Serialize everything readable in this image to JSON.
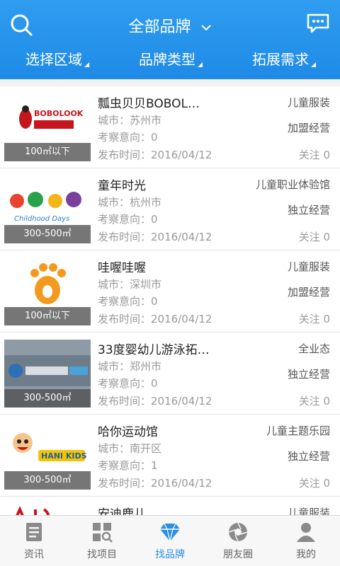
{
  "header": {
    "title": "全部品牌",
    "filters": [
      "选择区域",
      "品牌类型",
      "拓展需求"
    ],
    "colors": {
      "bar": "#2f9df0",
      "accent": "#2b8fe6"
    },
    "icons": {
      "left": "search-icon",
      "right": "message-icon",
      "title": "chevron-down-icon"
    }
  },
  "brands": [
    {
      "name": "瓢虫贝贝BOBOL…",
      "city": "城市：苏州市",
      "visits": "考察意向：0",
      "date": "发布时间：2016/04/12",
      "category": "儿童服装",
      "operation": "加盟经营",
      "follow": "关注 0",
      "area": "100㎡以下",
      "logo": "BOBOLOOK 瓢虫贝贝"
    },
    {
      "name": "童年时光",
      "city": "城市：杭州市",
      "visits": "考察意向：0",
      "date": "发布时间：2016/04/12",
      "category": "儿童职业体验馆",
      "operation": "独立经营",
      "follow": "关注 0",
      "area": "300-500㎡",
      "logo": "童年时光 Childhood Days"
    },
    {
      "name": "哇喔哇喔",
      "city": "城市：深圳市",
      "visits": "考察意向：0",
      "date": "发布时间：2016/04/12",
      "category": "儿童服装",
      "operation": "加盟经营",
      "follow": "关注 0",
      "area": "100㎡以下",
      "logo": "paw logo"
    },
    {
      "name": "33度婴幼儿游泳拓…",
      "city": "城市：郑州市",
      "visits": "考察意向：0",
      "date": "发布时间：2016/04/12",
      "category": "全业态",
      "operation": "独立经营",
      "follow": "关注 0",
      "area": "300-500㎡",
      "logo": "33 婴幼儿游泳拓展乐园"
    },
    {
      "name": "哈你运动馆",
      "city": "城市：南开区",
      "visits": "考察意向：1",
      "date": "发布时间：2016/04/12",
      "category": "儿童主题乐园",
      "operation": "独立经营",
      "follow": "关注 0",
      "area": "300-500㎡",
      "logo": "HANI KIDS 哈你运动馆"
    },
    {
      "name": "安迪鹿儿",
      "city": "",
      "visits": "",
      "date": "",
      "category": "儿童服装",
      "operation": "",
      "follow": "",
      "area": "",
      "logo": ""
    }
  ],
  "tabbar": {
    "tabs": [
      {
        "label": "资讯",
        "icon": "news-icon",
        "active": false
      },
      {
        "label": "找项目",
        "icon": "grid-search-icon",
        "active": false
      },
      {
        "label": "找品牌",
        "icon": "diamond-icon",
        "active": true
      },
      {
        "label": "朋友圈",
        "icon": "aperture-icon",
        "active": false
      },
      {
        "label": "我的",
        "icon": "person-icon",
        "active": false
      }
    ]
  }
}
